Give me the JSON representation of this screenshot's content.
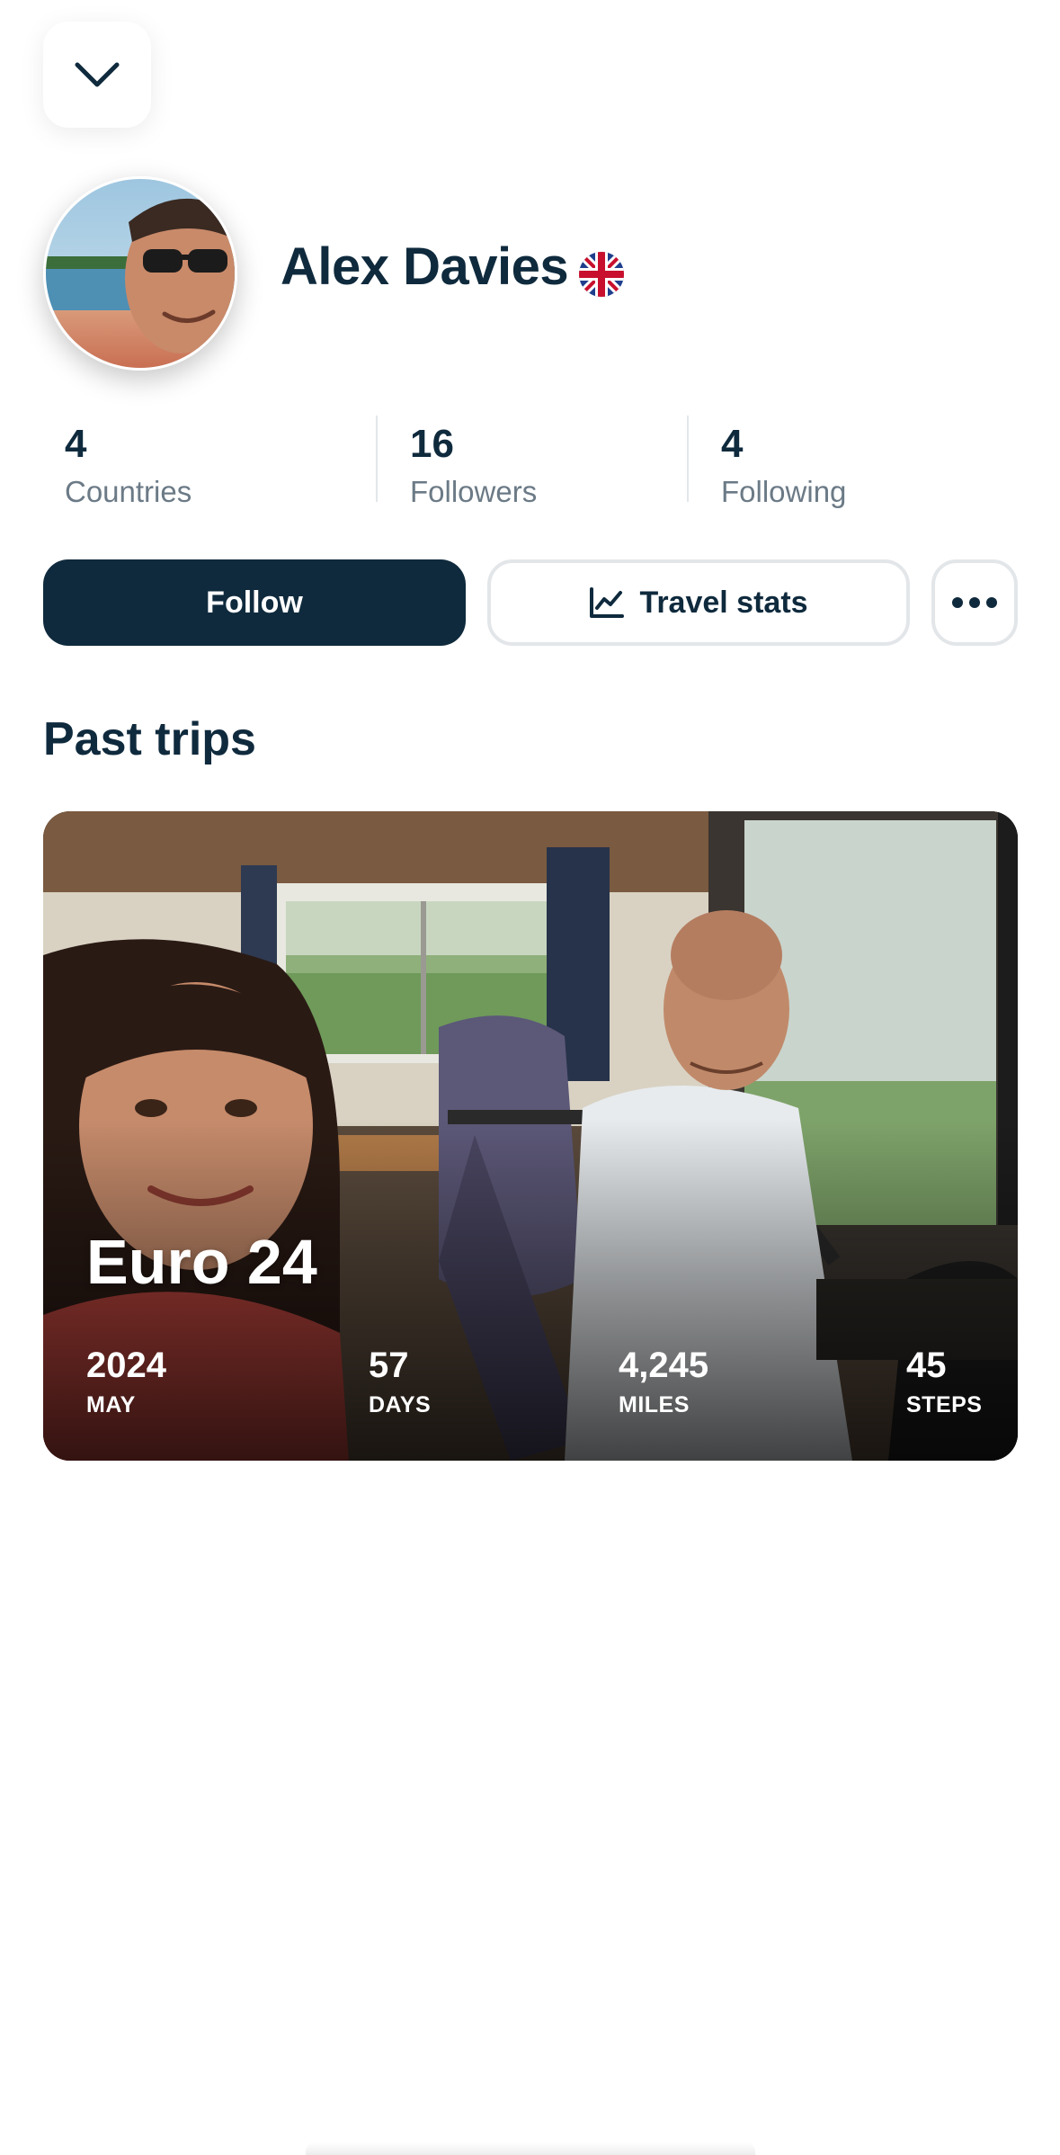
{
  "header": {
    "back_icon": "chevron-down-icon"
  },
  "profile": {
    "name": "Alex Davies",
    "flag_icon": "uk-flag-icon"
  },
  "stats": [
    {
      "value": "4",
      "label": "Countries"
    },
    {
      "value": "16",
      "label": "Followers"
    },
    {
      "value": "4",
      "label": "Following"
    }
  ],
  "actions": {
    "follow_label": "Follow",
    "travel_stats_label": "Travel stats",
    "travel_stats_icon": "line-chart-icon",
    "more_icon": "more-horizontal-icon"
  },
  "past_trips": {
    "title": "Past trips",
    "trips": [
      {
        "name": "Euro 24",
        "stats": [
          {
            "value": "2024",
            "label": "MAY"
          },
          {
            "value": "57",
            "label": "DAYS"
          },
          {
            "value": "4,245",
            "label": "MILES"
          },
          {
            "value": "45",
            "label": "STEPS"
          }
        ]
      }
    ]
  },
  "colors": {
    "primary": "#0f2a3d",
    "muted_text": "#6b7a86",
    "border": "#e3e6e9"
  }
}
